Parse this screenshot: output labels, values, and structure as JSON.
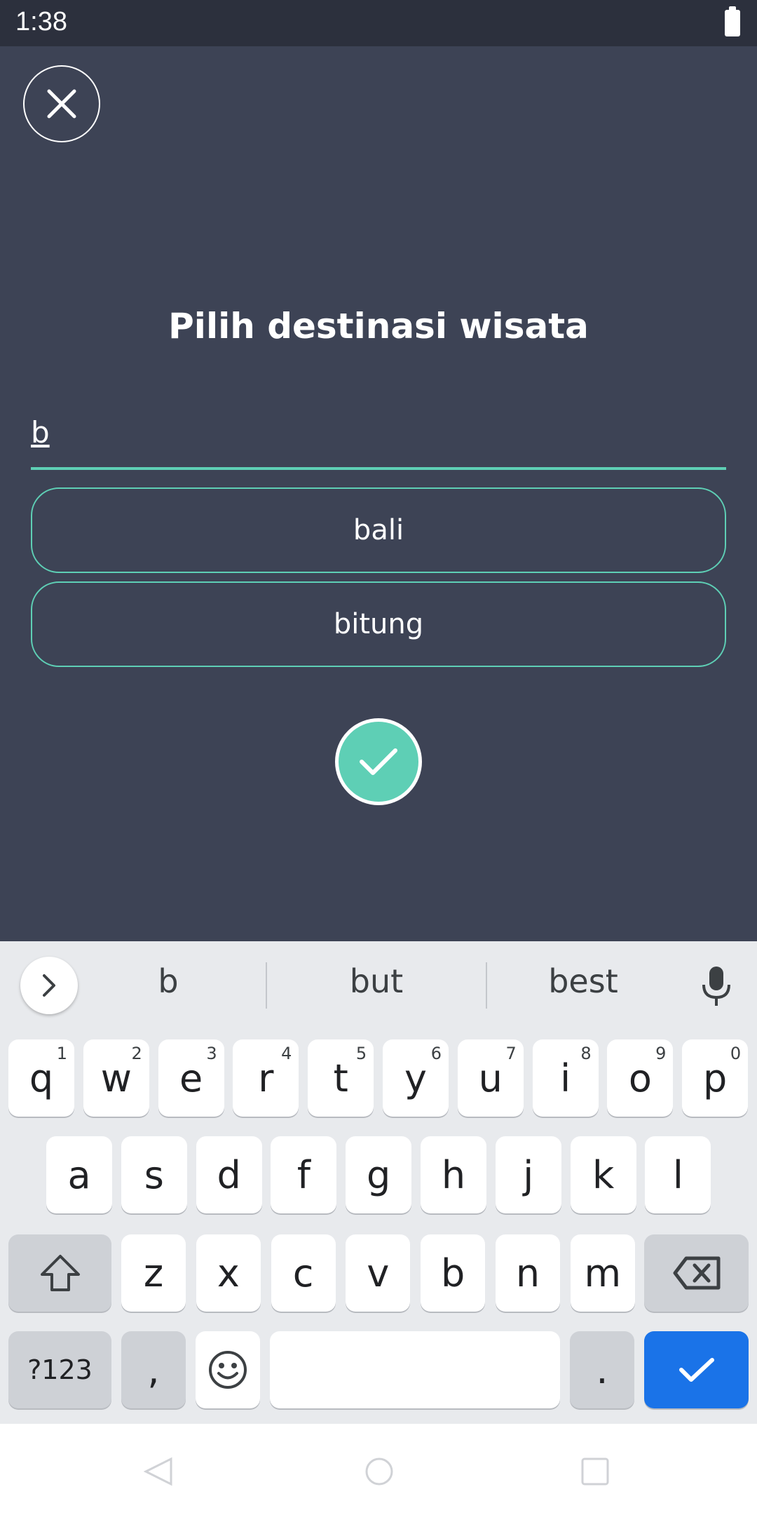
{
  "status_bar": {
    "time": "1:38"
  },
  "app": {
    "title": "Pilih destinasi wisata",
    "search": {
      "value": "b"
    },
    "suggestions": [
      "bali",
      "bitung"
    ],
    "accent_color": "#5ecfb5",
    "background_color": "#3d4355"
  },
  "keyboard": {
    "word_suggestions": [
      "b",
      "but",
      "best"
    ],
    "row1": [
      {
        "k": "q",
        "h": "1"
      },
      {
        "k": "w",
        "h": "2"
      },
      {
        "k": "e",
        "h": "3"
      },
      {
        "k": "r",
        "h": "4"
      },
      {
        "k": "t",
        "h": "5"
      },
      {
        "k": "y",
        "h": "6"
      },
      {
        "k": "u",
        "h": "7"
      },
      {
        "k": "i",
        "h": "8"
      },
      {
        "k": "o",
        "h": "9"
      },
      {
        "k": "p",
        "h": "0"
      }
    ],
    "row2": [
      "a",
      "s",
      "d",
      "f",
      "g",
      "h",
      "j",
      "k",
      "l"
    ],
    "row3": [
      "z",
      "x",
      "c",
      "v",
      "b",
      "n",
      "m"
    ],
    "symbols_label": "?123",
    "comma": ",",
    "period": ".",
    "enter_color": "#1a73e8"
  }
}
